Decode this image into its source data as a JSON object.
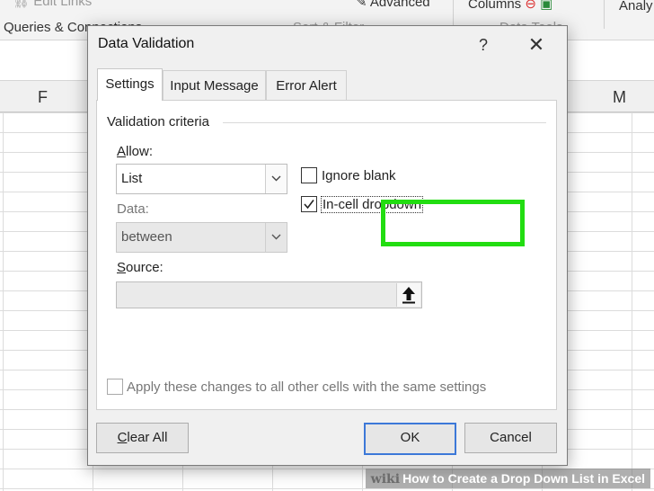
{
  "ribbon": {
    "edit_links": "Edit Links",
    "queries": "Queries & Connections",
    "sort_filter": "Sort & Filter",
    "advanced": "Advanced",
    "columns": "Columns",
    "data_tools": "Data Tools",
    "analysis": "Analy"
  },
  "sheet": {
    "col_f": "F",
    "col_m": "M"
  },
  "dialog": {
    "title": "Data Validation",
    "help": "?",
    "close": "✕",
    "tabs": [
      "Settings",
      "Input Message",
      "Error Alert"
    ],
    "validation_criteria": "Validation criteria",
    "allow_label": "Allow:",
    "allow_value": "List",
    "data_label": "Data:",
    "data_value": "between",
    "ignore_blank": "Ignore blank",
    "ignore_blank_checked": false,
    "in_cell_dropdown": "In-cell dropdown",
    "in_cell_dropdown_checked": true,
    "source_label": "Source:",
    "source_value": "",
    "apply_all": "Apply these changes to all other cells with the same settings",
    "apply_all_checked": false,
    "clear_all": "Clear All",
    "ok": "OK",
    "cancel": "Cancel"
  },
  "highlight_color": "#22dd11",
  "watermark": {
    "logo": "wiki",
    "text": "How to Create a Drop Down List in Excel"
  }
}
